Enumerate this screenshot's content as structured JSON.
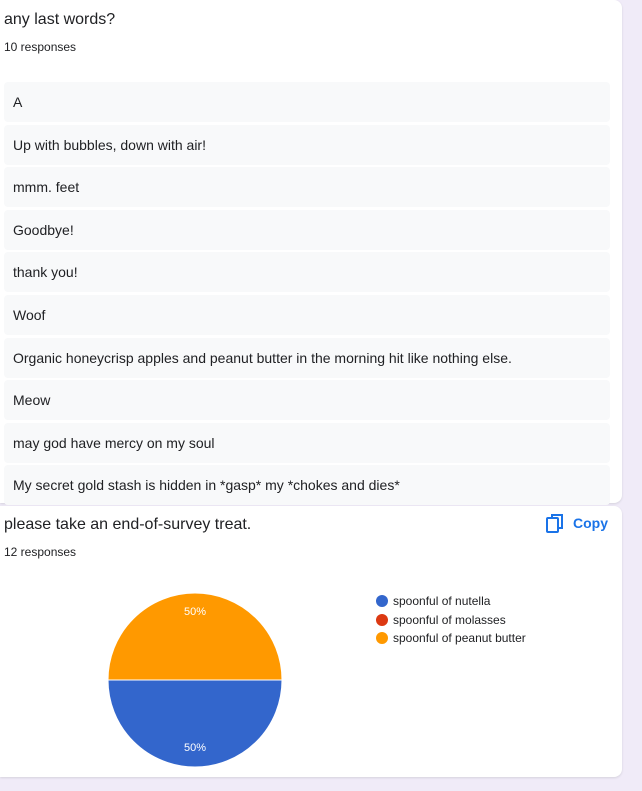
{
  "question1": {
    "title": "any last words?",
    "count": "10 responses",
    "responses": [
      "A",
      "Up with bubbles, down with air!",
      "mmm. feet",
      "Goodbye!",
      "thank you!",
      "Woof",
      "Organic honeycrisp apples and peanut butter in the morning hit like nothing else.",
      "Meow",
      "may god have mercy on my soul",
      "My secret gold stash is hidden in *gasp* my *chokes and dies*"
    ]
  },
  "question2": {
    "title": "please take an end-of-survey treat.",
    "count": "12 responses",
    "copy_label": "Copy",
    "copy_icon": "copy-icon",
    "chart_data": {
      "type": "pie",
      "legend_position": "right",
      "slices": [
        {
          "label": "spoonful of nutella",
          "value": 50,
          "color": "#3366cc",
          "display": "50%"
        },
        {
          "label": "spoonful of molasses",
          "value": 0,
          "color": "#dc3912",
          "display": ""
        },
        {
          "label": "spoonful of peanut butter",
          "value": 50,
          "color": "#ff9900",
          "display": "50%"
        }
      ]
    }
  },
  "colors": {
    "background": "#f0ebf8",
    "accent": "#1a73e8",
    "response_bg": "#f8f9fa"
  }
}
